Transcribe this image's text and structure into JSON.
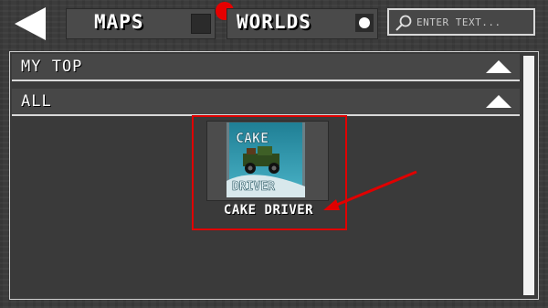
{
  "header": {
    "tabs": [
      {
        "label": "MAPS",
        "checked": false
      },
      {
        "label": "WORLDS",
        "selected": true
      }
    ],
    "notification_color": "#e60000",
    "search": {
      "placeholder": "ENTER TEXT..."
    }
  },
  "sections": [
    {
      "label": "MY TOP",
      "icon": "collapse-up-icon"
    },
    {
      "label": "ALL",
      "icon": "collapse-up-icon"
    }
  ],
  "items": [
    {
      "label": "CAKE DRIVER",
      "thumbnail": {
        "line1": "CAKE",
        "line2": "DRIVER",
        "icon": "truck-icon"
      },
      "highlighted": true
    }
  ],
  "annotation": {
    "color": "#e00000",
    "type": "arrow-pointing-to-item"
  },
  "icons": {
    "back": "back-arrow-icon",
    "search": "search-icon"
  }
}
